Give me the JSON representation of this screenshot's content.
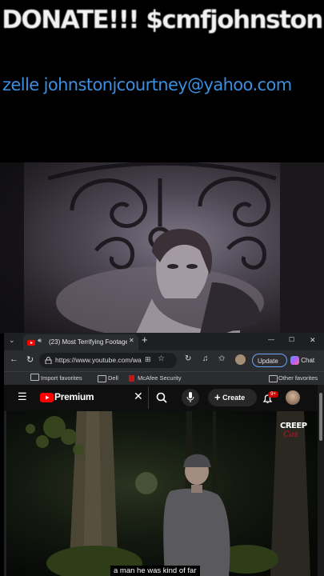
{
  "banner": {
    "donate_text": "DONATE!!! $cmfjohnston",
    "zelle_text": "zelle johnstonjcourtney@yahoo.com"
  },
  "browser": {
    "tab": {
      "title": "(23) Most Terrifying Footage E",
      "close_glyph": "✕",
      "new_tab_glyph": "+"
    },
    "window_controls": {
      "minimize": "—",
      "maximize": "☐",
      "close": "✕"
    },
    "address_bar": {
      "url": "https://www.youtube.com/wat...",
      "update_label": "Update",
      "update_more": "···",
      "chat_label": "Chat"
    },
    "favorites": {
      "items": [
        "Import favorites",
        "Dell",
        "McAfee Security"
      ],
      "other_label": "Other favorites"
    },
    "youtube": {
      "logo_text": "Premium",
      "create_label": "Create",
      "notification_count": "9+"
    },
    "video": {
      "channel_watermark_line1": "CREEP",
      "channel_watermark_line2": "Cas",
      "caption": "a man he was kind of far"
    }
  },
  "colors": {
    "zelle_blue": "#3a8fe0",
    "youtube_red": "#ff0000",
    "update_border": "#6aa7ff"
  }
}
